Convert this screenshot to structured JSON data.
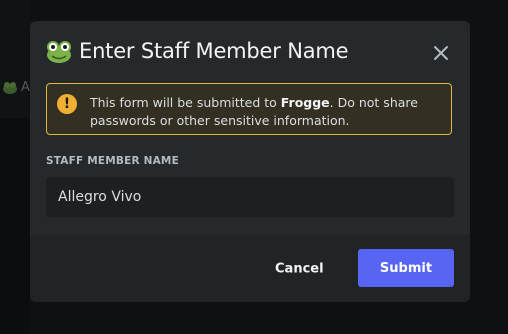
{
  "dialog": {
    "title": "Enter Staff Member Name",
    "title_icon": "frog-emoji-icon",
    "close_icon": "close-icon"
  },
  "warning": {
    "icon": "warning-icon",
    "icon_glyph": "!",
    "text_before": "This form will be submitted to ",
    "app_name": "Frogge",
    "text_after": ". Do not share passwords or other sensitive information."
  },
  "field": {
    "label": "STAFF MEMBER NAME",
    "value": "Allegro Vivo"
  },
  "footer": {
    "cancel_label": "Cancel",
    "submit_label": "Submit"
  },
  "background": {
    "letter": "A"
  },
  "colors": {
    "accent": "#5865f2",
    "warning_border": "#e0b741",
    "warning_icon": "#f0b132"
  }
}
